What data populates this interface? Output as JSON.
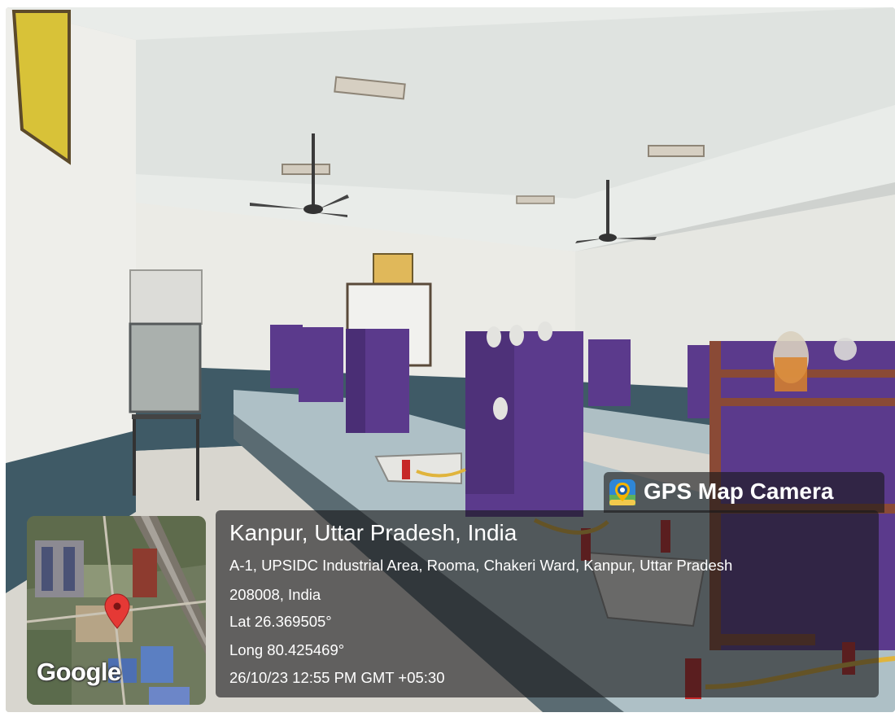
{
  "overlay": {
    "brand": "GPS Map Camera",
    "city": "Kanpur, Uttar Pradesh, India",
    "address_line1": "A-1, UPSIDC Industrial Area, Rooma, Chakeri Ward, Kanpur, Uttar Pradesh",
    "address_line2": "208008, India",
    "lat": "Lat 26.369505°",
    "long": "Long 80.425469°",
    "datetime": "26/10/23 12:55 PM GMT +05:30",
    "map_logo": "Google"
  },
  "colors": {
    "cabinet_purple": "#5b3a8c",
    "wood_frame": "#8a4a36",
    "bench_top": "#aec0c6",
    "wall_dado": "#3f5a66",
    "pin_red": "#e53935"
  },
  "icons": [
    "gps-map-camera-icon",
    "map-pin-icon"
  ]
}
